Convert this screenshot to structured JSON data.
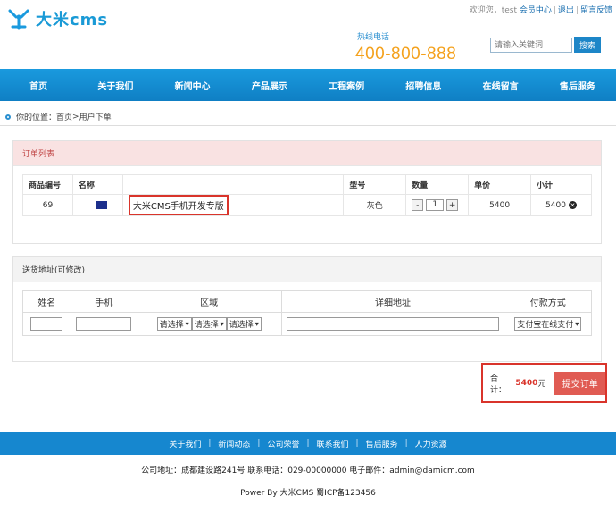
{
  "header": {
    "logo_text": "大米cms",
    "top_links": {
      "welcome": "欢迎您，test",
      "member_center": "会员中心",
      "logout": "退出",
      "feedback": "留言反馈"
    },
    "hotline_label": "热线电话",
    "hotline": "400-800-888",
    "search_placeholder": "请输入关键词",
    "search_button": "搜索"
  },
  "nav": [
    "首页",
    "关于我们",
    "新闻中心",
    "产品展示",
    "工程案例",
    "招聘信息",
    "在线留言",
    "售后服务"
  ],
  "breadcrumb": {
    "label": "你的位置：",
    "home": "首页",
    "sep": " > ",
    "current": "用户下单"
  },
  "order": {
    "title": "订单列表",
    "columns": [
      "商品编号",
      "名称",
      "",
      "型号",
      "数量",
      "单价",
      "小计"
    ],
    "rows": [
      {
        "id": "69",
        "name": "大米CMS手机开发专版",
        "model": "灰色",
        "qty": "1",
        "price": "5400",
        "subtotal": "5400"
      }
    ],
    "minus": "-",
    "plus": "+",
    "remove": "✕"
  },
  "shipping": {
    "title": "送货地址(可修改)",
    "columns": [
      "姓名",
      "手机",
      "区域",
      "详细地址",
      "付款方式"
    ],
    "region_select": "请选择",
    "payment_select": "支付宝在线支付"
  },
  "summary": {
    "total_label": "合计：",
    "total_value": "5400",
    "currency": "元",
    "submit": "提交订单"
  },
  "footer": {
    "links": [
      "关于我们",
      "新闻动态",
      "公司荣誉",
      "联系我们",
      "售后服务",
      "人力资源"
    ],
    "address": "公司地址：成都建设路241号 联系电话：029-00000000 电子邮件：admin@damicm.com",
    "powered": "Power By 大米CMS  蜀ICP备123456"
  },
  "colors": {
    "brand": "#1a9ade",
    "hotline": "#f4a11c",
    "accent_red": "#d9342b"
  }
}
